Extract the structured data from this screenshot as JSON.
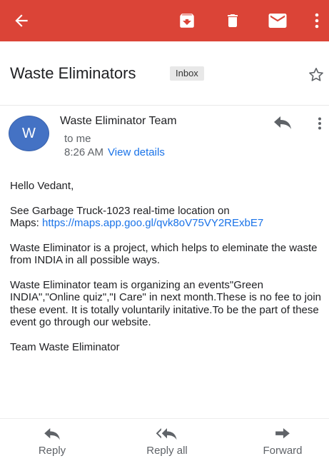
{
  "toolbar": {
    "back_icon": "arrow-left-icon",
    "archive_icon": "archive-icon",
    "delete_icon": "trash-icon",
    "mail_icon": "mail-icon",
    "overflow_icon": "more-vertical-icon",
    "bar_color": "#db4437"
  },
  "email": {
    "subject": "Waste Eliminators",
    "label": "Inbox",
    "star_icon": "star-outline-icon",
    "sender_initial": "W",
    "sender_name": "Waste Eliminator Team",
    "to": "to me",
    "time": "8:26 AM",
    "view_details": "View details",
    "body": {
      "greeting": "Hello Vedant,",
      "location_line1": "See Garbage Truck-1023 real-time location on",
      "location_prefix": "Maps: ",
      "location_link": "https://maps.app.goo.gl/qvk8oV75VY2RExbE7",
      "para2": "Waste Eliminator is a project, which helps to eleminate the waste from INDIA in all possible ways.",
      "para3": "Waste Eliminator team is organizing an events\"Green INDIA\",\"Online quiz\",\"I Care\" in next month.These is no fee to join these event. It is totally voluntarily initative.To be the part of these event go through our website.",
      "signature": "Team Waste Eliminator"
    }
  },
  "actions": {
    "reply": "Reply",
    "reply_all": "Reply all",
    "forward": "Forward"
  },
  "colors": {
    "accent": "#db4437",
    "link": "#1a73e8",
    "avatar": "#4472c4"
  }
}
